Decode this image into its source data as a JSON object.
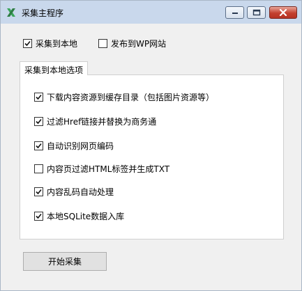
{
  "window": {
    "title": "采集主程序",
    "icon": "x-app-icon",
    "controls": {
      "minimize": "minimize-icon",
      "maximize": "maximize-icon",
      "close": "close-icon"
    }
  },
  "options": {
    "save_local": {
      "label": "采集到本地",
      "checked": true
    },
    "publish_wp": {
      "label": "发布到WP网站",
      "checked": false
    }
  },
  "tab": {
    "label": "采集到本地选项"
  },
  "local_options": [
    {
      "label": "下载内容资源到缓存目录（包括图片资源等）",
      "checked": true
    },
    {
      "label": "过滤Href链接并替换为商务通",
      "checked": true
    },
    {
      "label": "自动识别网页编码",
      "checked": true
    },
    {
      "label": "内容页过滤HTML标签并生成TXT",
      "checked": false
    },
    {
      "label": "内容乱码自动处理",
      "checked": true
    },
    {
      "label": "本地SQLite数据入库",
      "checked": true
    }
  ],
  "start_button": {
    "label": "开始采集"
  },
  "colors": {
    "titlebar": "#c9d8ec",
    "icon_green": "#3aa55a",
    "close_red": "#c4402f"
  }
}
